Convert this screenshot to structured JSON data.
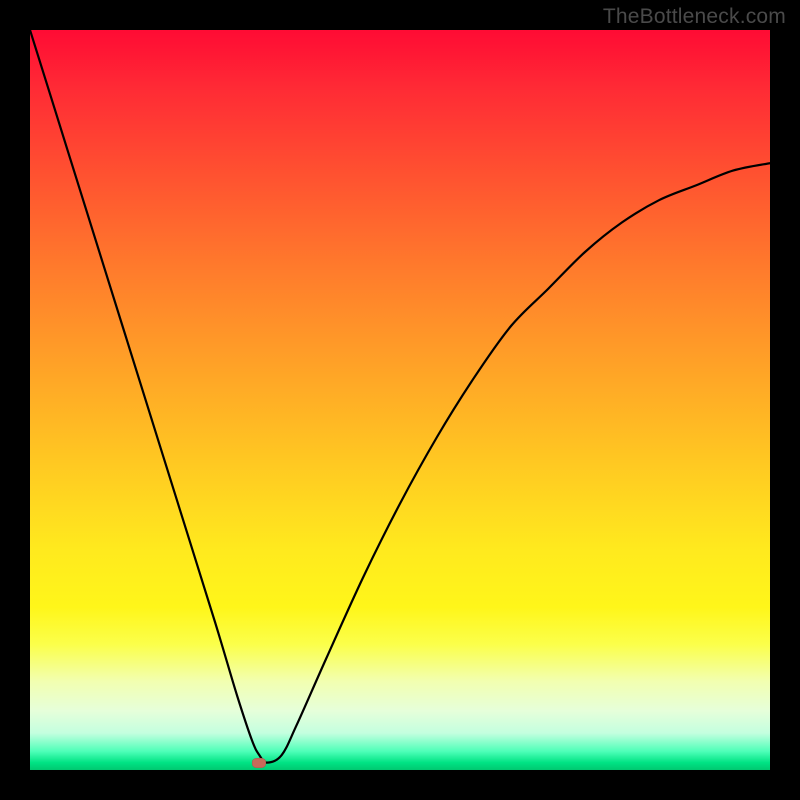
{
  "watermark": "TheBottleneck.com",
  "chart_data": {
    "type": "line",
    "title": "",
    "xlabel": "",
    "ylabel": "",
    "xlim": [
      0,
      100
    ],
    "ylim": [
      0,
      100
    ],
    "grid": false,
    "legend": false,
    "series": [
      {
        "name": "bottleneck-curve",
        "x": [
          0,
          5,
          10,
          15,
          20,
          25,
          28,
          30,
          31,
          32,
          34,
          36,
          40,
          45,
          50,
          55,
          60,
          65,
          70,
          75,
          80,
          85,
          90,
          95,
          100
        ],
        "values": [
          100,
          84,
          68,
          52,
          36,
          20,
          10,
          4,
          2,
          1,
          2,
          6,
          15,
          26,
          36,
          45,
          53,
          60,
          65,
          70,
          74,
          77,
          79,
          81,
          82
        ]
      }
    ],
    "marker": {
      "name": "optimal-point",
      "x": 31,
      "y": 1,
      "color": "#c76a5a"
    },
    "background_gradient": {
      "top": "#ff0b34",
      "bottom": "#00c870",
      "stops": [
        "#ff0b34",
        "#ff7a2c",
        "#ffe91e",
        "#4dffb8",
        "#00c870"
      ]
    }
  }
}
